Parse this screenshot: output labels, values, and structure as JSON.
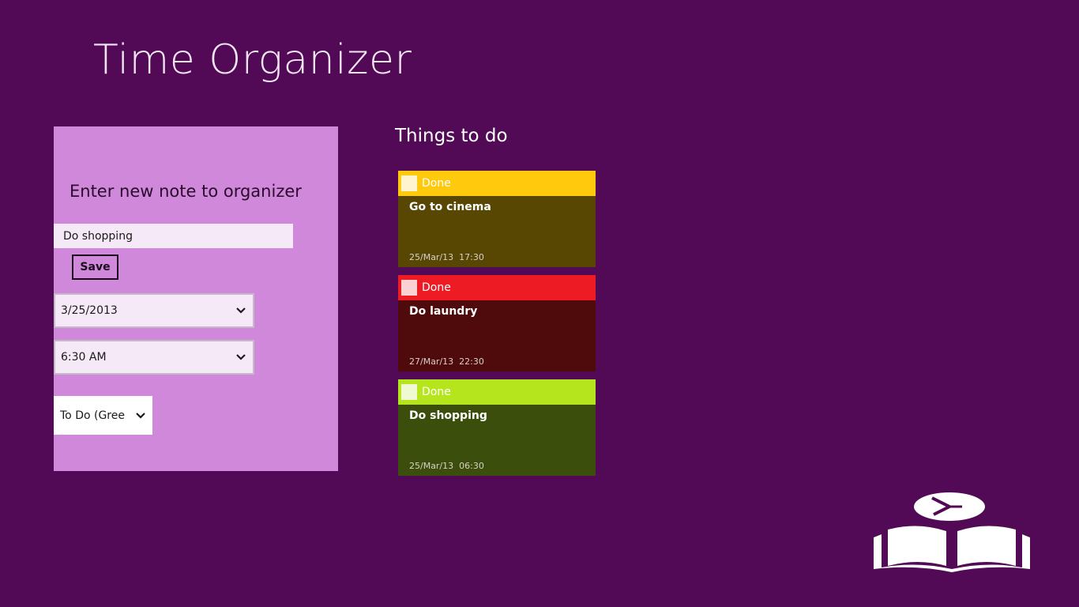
{
  "app": {
    "title": "Time Organizer"
  },
  "entry": {
    "heading": "Enter new note to organizer",
    "note_value": "Do shopping",
    "save_label": "Save",
    "date_value": "3/25/2013",
    "time_value": "6:30 AM",
    "category_value": "To Do (Gree"
  },
  "todo": {
    "heading": "Things to do",
    "notes": [
      {
        "done_label": "Done",
        "title": "Go to cinema",
        "date": "25/Mar/13",
        "time": "17:30",
        "header_color": "#ffc90e",
        "body_color": "#574703"
      },
      {
        "done_label": "Done",
        "title": "Do laundry",
        "date": "27/Mar/13",
        "time": "22:30",
        "header_color": "#ed1c24",
        "body_color": "#4f0a0c"
      },
      {
        "done_label": "Done",
        "title": "Do shopping",
        "date": "25/Mar/13",
        "time": "06:30",
        "header_color": "#b5e61d",
        "body_color": "#3b4e0c"
      }
    ]
  },
  "colors": {
    "background": "#520a56",
    "panel": "#d089da"
  },
  "icons": {
    "logo": "book-clock-logo-icon",
    "dropdown": "chevron-down-icon"
  }
}
